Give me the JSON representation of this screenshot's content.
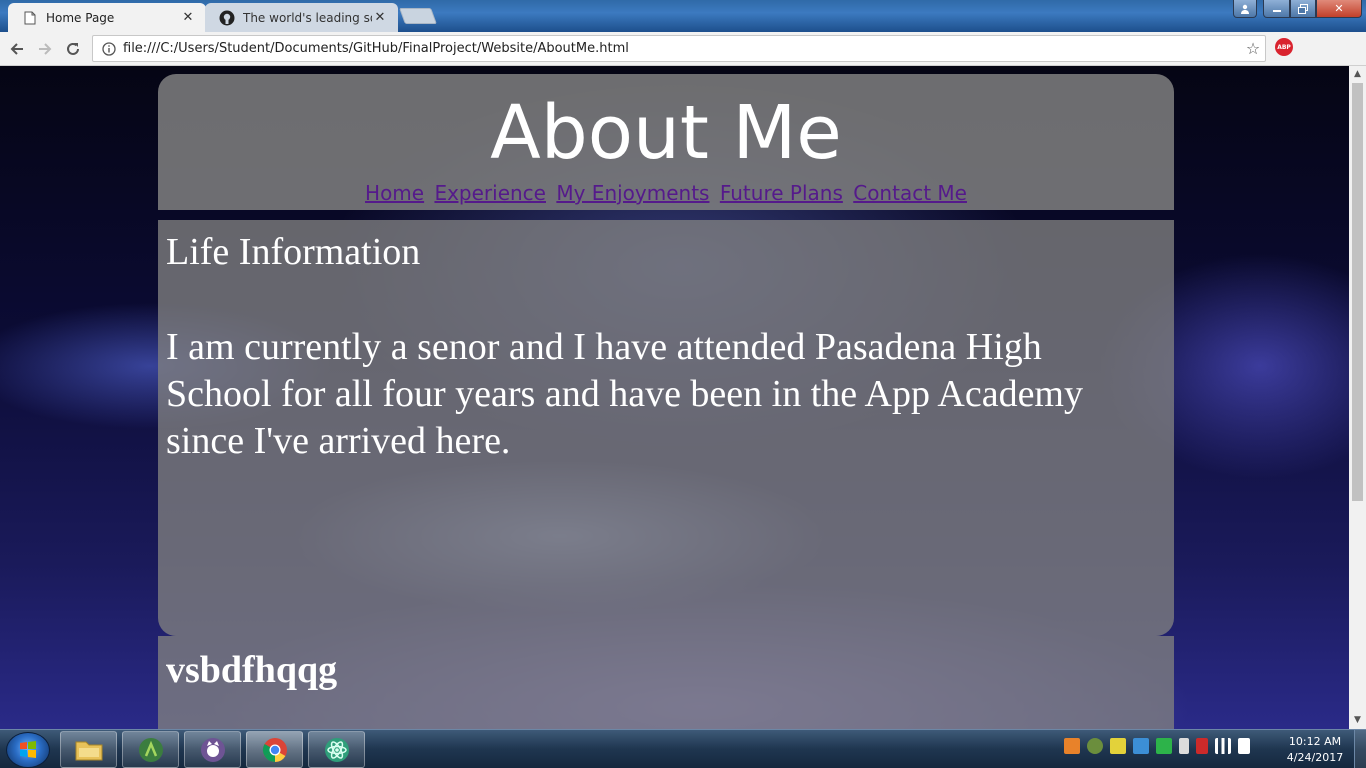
{
  "browser": {
    "tabs": [
      {
        "title": "Home Page",
        "active": true
      },
      {
        "title": "The world's leading softw",
        "active": false
      }
    ],
    "url": "file:///C:/Users/Student/Documents/GitHub/FinalProject/Website/AboutMe.html",
    "extension_label": "ABP"
  },
  "page": {
    "title": "About Me",
    "nav": [
      "Home",
      "Experience",
      "My Enjoyments",
      "Future Plans",
      "Contact Me"
    ],
    "sections": [
      {
        "title": "Life Information",
        "body": "I am currently a senor and I have attended Pasadena High School for all four years and have been in the App Academy since I've arrived here."
      },
      {
        "title": "vsbdfhqqg"
      }
    ],
    "colors": {
      "panel": "#808080",
      "link": "#551a8b",
      "text": "#ffffff"
    }
  },
  "taskbar": {
    "apps": [
      "file-explorer",
      "android-studio",
      "github-desktop",
      "chrome",
      "atom"
    ],
    "clock": {
      "time": "10:12 AM",
      "date": "4/24/2017"
    }
  }
}
